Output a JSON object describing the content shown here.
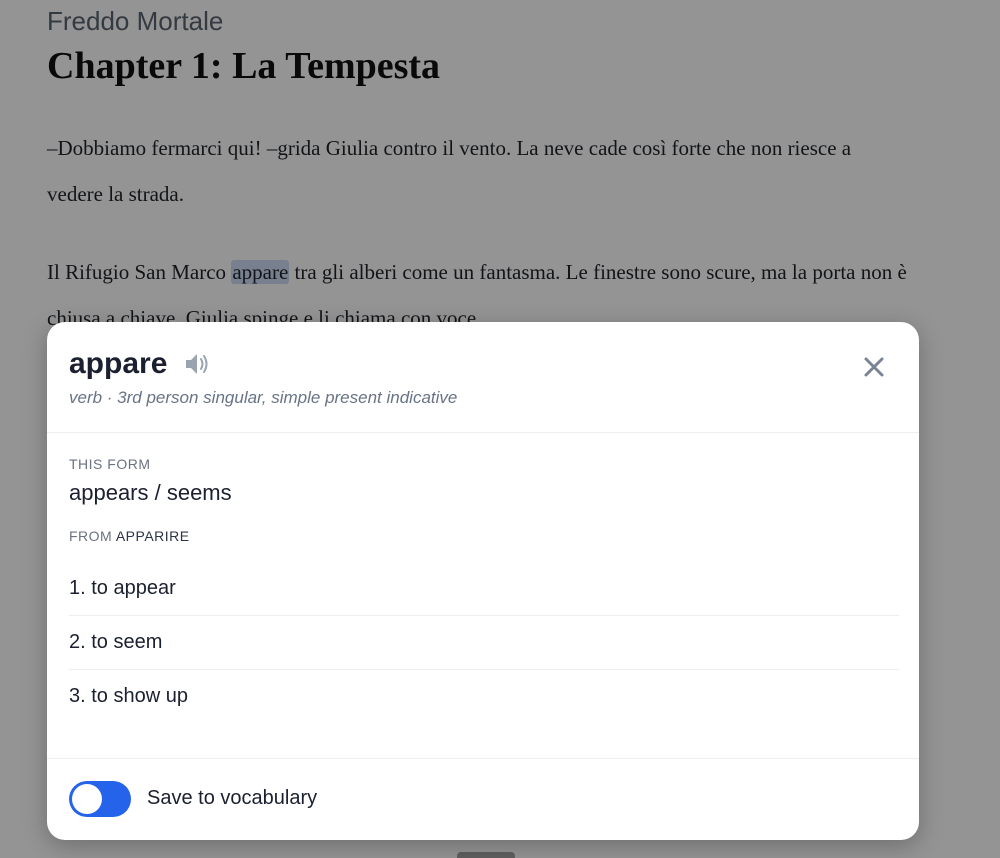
{
  "reader": {
    "book_title": "Freddo Mortale",
    "chapter_title": "Chapter 1: La Tempesta",
    "paragraph1": "–Dobbiamo fermarci qui! –grida Giulia contro il vento. La neve cade così forte che non riesce a vedere la strada.",
    "paragraph2_before": "Il Rifugio San Marco ",
    "paragraph2_highlight": "appare",
    "paragraph2_after": " tra gli alberi come un fantasma. Le finestre sono scure, ma la porta non è chiusa a chiave. Giulia spinge e li chiama con voce."
  },
  "popup": {
    "word": "appare",
    "speaker_icon": "speaker-icon",
    "close_icon": "close-icon",
    "grammar": "verb · 3rd person singular, simple present indicative",
    "this_form_label": "THIS FORM",
    "this_form_value": "appears / seems",
    "from_label": "FROM",
    "lemma": "APPARIRE",
    "senses": [
      "1. to appear",
      "2. to seem",
      "3. to show up"
    ],
    "save_label": "Save to vocabulary",
    "save_enabled": true
  },
  "colors": {
    "accent": "#2563eb",
    "highlight": "#cfdcf6",
    "overlay": "rgba(0,0,0,0.42)"
  }
}
